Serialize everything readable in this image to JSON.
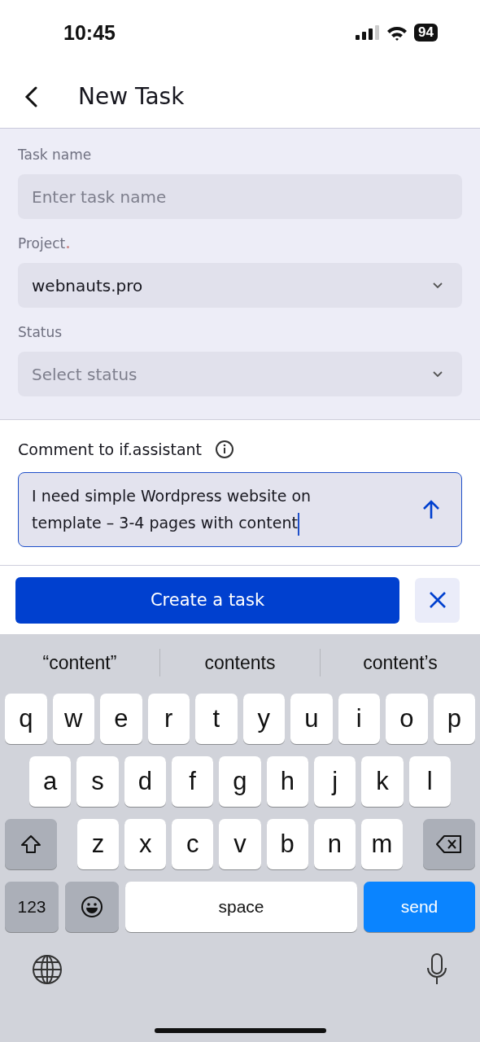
{
  "status_bar": {
    "time": "10:45",
    "battery": "94"
  },
  "header": {
    "title": "New Task"
  },
  "fields": [
    {
      "kind": "text",
      "label": "Task name",
      "required": false,
      "placeholder": "Enter task name"
    },
    {
      "kind": "select",
      "label": "Project",
      "required": true,
      "value": "webnauts.pro"
    },
    {
      "kind": "select",
      "label": "Status",
      "required": false,
      "placeholder": "Select status"
    }
  ],
  "comment": {
    "label": "Comment to if.assistant",
    "value": "I need simple Wordpress website on template – 3-4 pages with content"
  },
  "actions": {
    "primary": "Create a task"
  },
  "keyboard": {
    "suggestions": [
      "“content”",
      "contents",
      "content’s"
    ],
    "rows": [
      [
        "q",
        "w",
        "e",
        "r",
        "t",
        "y",
        "u",
        "i",
        "o",
        "p"
      ],
      [
        "a",
        "s",
        "d",
        "f",
        "g",
        "h",
        "j",
        "k",
        "l"
      ],
      [
        "z",
        "x",
        "c",
        "v",
        "b",
        "n",
        "m"
      ]
    ],
    "numbers": "123",
    "space": "space",
    "send": "send"
  }
}
